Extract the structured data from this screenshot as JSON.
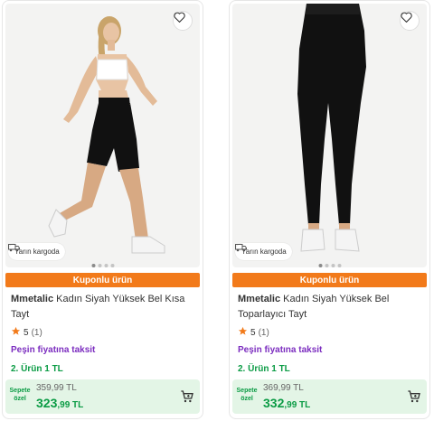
{
  "colors": {
    "accent": "#f27a1a",
    "installment": "#7b2cbf",
    "green": "#0a9b44",
    "price_bg": "#e3f5e6",
    "star": "#f27a1a"
  },
  "products": [
    {
      "icons": {
        "favorite": "heart-icon",
        "cargo": "delivery-truck-icon",
        "rating": "star-icon",
        "cart": "add-to-cart-icon"
      },
      "cargo_badge": "Yarın kargoda",
      "carousel_dots": 4,
      "carousel_active": 0,
      "coupon_label": "Kuponlu ürün",
      "brand": "Mmetalic",
      "name": "Kadın Siyah Yüksek Bel Kısa Tayt",
      "rating": "5",
      "rating_count": "(1)",
      "installment": "Peşin fiyatına taksit",
      "promo": "2. Ürün 1 TL",
      "basket_label": "Sepete özel",
      "old_price": "359,99 TL",
      "price_main": "323",
      "price_rest": ",99 TL"
    },
    {
      "icons": {
        "favorite": "heart-icon",
        "cargo": "delivery-truck-icon",
        "rating": "star-icon",
        "cart": "add-to-cart-icon"
      },
      "cargo_badge": "Yarın kargoda",
      "carousel_dots": 4,
      "carousel_active": 0,
      "coupon_label": "Kuponlu ürün",
      "brand": "Mmetalic",
      "name": "Kadın Siyah Yüksek Bel Toparlayıcı Tayt",
      "rating": "5",
      "rating_count": "(1)",
      "installment": "Peşin fiyatına taksit",
      "promo": "2. Ürün 1 TL",
      "basket_label": "Sepete özel",
      "old_price": "369,99 TL",
      "price_main": "332",
      "price_rest": ",99 TL"
    }
  ]
}
